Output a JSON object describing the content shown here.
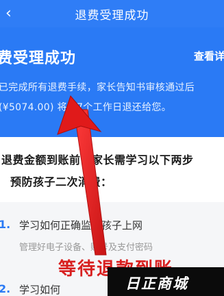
{
  "nav": {
    "back_glyph": "‹",
    "title": "退费受理成功"
  },
  "hero": {
    "title": "费受理成功",
    "view_link": "查看详",
    "line1": "已完成所有退费手续，家长告知书审核通过后",
    "line2": "(¥5074.00) 将在7个工作日退还给您。"
  },
  "notice": {
    "line1": "退费金额到账前，家长需学习以下两步",
    "line2": "预防孩子二次消费："
  },
  "items": [
    {
      "num": "1.",
      "title": "学习如何正确监管孩子上网",
      "sub": "管理好电子设备、账号及支付密码"
    },
    {
      "num": "2.",
      "title": "学习如何"
    }
  ],
  "overlay": {
    "caption": "等待退款到账",
    "color": "#d81f1f"
  },
  "watermark": {
    "text": "日正商城"
  },
  "colors": {
    "primary": "#2a7af5",
    "arrow": "#d81f1f"
  }
}
